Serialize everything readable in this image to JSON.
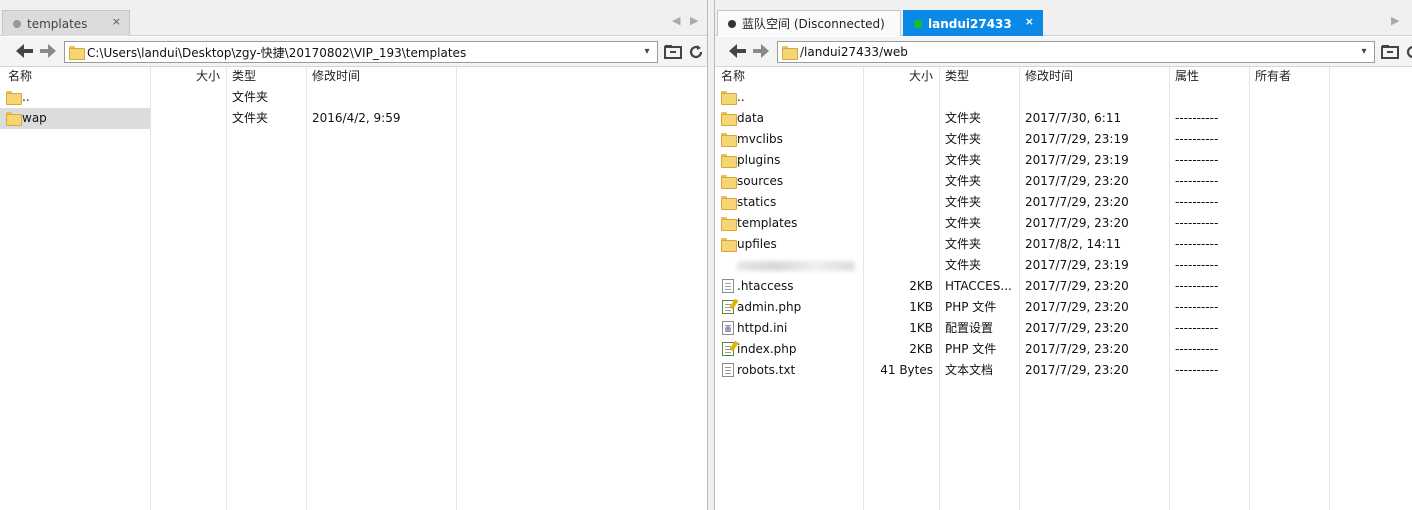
{
  "left": {
    "tabs": [
      {
        "label": "templates",
        "close": "×"
      }
    ],
    "path": "C:\\Users\\landui\\Desktop\\zgy-快捷\\20170802\\VIP_193\\templates",
    "columns": {
      "name": "名称",
      "size": "大小",
      "type": "类型",
      "modified": "修改时间"
    },
    "rows": [
      {
        "name": "..",
        "size": "",
        "type": "文件夹",
        "modified": "",
        "icon": "folder-icon"
      },
      {
        "name": "wap",
        "size": "",
        "type": "文件夹",
        "modified": "2016/4/2, 9:59",
        "icon": "folder-icon"
      }
    ]
  },
  "right": {
    "tabs": [
      {
        "label": "蓝队空间 (Disconnected)",
        "close": ""
      },
      {
        "label": "landui27433",
        "close": "×"
      }
    ],
    "path": "/landui27433/web",
    "columns": {
      "name": "名称",
      "size": "大小",
      "type": "类型",
      "modified": "修改时间",
      "attrs": "属性",
      "owner": "所有者"
    },
    "rows": [
      {
        "name": "..",
        "size": "",
        "type": "",
        "modified": "",
        "attrs": "",
        "icon": "folder-icon"
      },
      {
        "name": "data",
        "size": "",
        "type": "文件夹",
        "modified": "2017/7/30, 6:11",
        "attrs": "----------",
        "icon": "folder-icon"
      },
      {
        "name": "mvclibs",
        "size": "",
        "type": "文件夹",
        "modified": "2017/7/29, 23:19",
        "attrs": "----------",
        "icon": "folder-icon"
      },
      {
        "name": "plugins",
        "size": "",
        "type": "文件夹",
        "modified": "2017/7/29, 23:19",
        "attrs": "----------",
        "icon": "folder-icon"
      },
      {
        "name": "sources",
        "size": "",
        "type": "文件夹",
        "modified": "2017/7/29, 23:20",
        "attrs": "----------",
        "icon": "folder-icon"
      },
      {
        "name": "statics",
        "size": "",
        "type": "文件夹",
        "modified": "2017/7/29, 23:20",
        "attrs": "----------",
        "icon": "folder-icon"
      },
      {
        "name": "templates",
        "size": "",
        "type": "文件夹",
        "modified": "2017/7/29, 23:20",
        "attrs": "----------",
        "icon": "folder-icon"
      },
      {
        "name": "upfiles",
        "size": "",
        "type": "文件夹",
        "modified": "2017/8/2, 14:11",
        "attrs": "----------",
        "icon": "folder-icon"
      },
      {
        "name": "",
        "size": "",
        "type": "文件夹",
        "modified": "2017/7/29, 23:19",
        "attrs": "----------",
        "icon": "blurred-icon"
      },
      {
        "name": ".htaccess",
        "size": "2KB",
        "type": "HTACCES...",
        "modified": "2017/7/29, 23:20",
        "attrs": "----------",
        "icon": "file-icon"
      },
      {
        "name": "admin.php",
        "size": "1KB",
        "type": "PHP 文件",
        "modified": "2017/7/29, 23:20",
        "attrs": "----------",
        "icon": "php-file-icon"
      },
      {
        "name": "httpd.ini",
        "size": "1KB",
        "type": "配置设置",
        "modified": "2017/7/29, 23:20",
        "attrs": "----------",
        "icon": "ini-file-icon"
      },
      {
        "name": "index.php",
        "size": "2KB",
        "type": "PHP 文件",
        "modified": "2017/7/29, 23:20",
        "attrs": "----------",
        "icon": "php-file-icon"
      },
      {
        "name": "robots.txt",
        "size": "41 Bytes",
        "type": "文本文档",
        "modified": "2017/7/29, 23:20",
        "attrs": "----------",
        "icon": "text-file-icon"
      }
    ]
  },
  "icons": {
    "dropdown": "▾",
    "tab_prev": "◀",
    "tab_next": "▶"
  }
}
